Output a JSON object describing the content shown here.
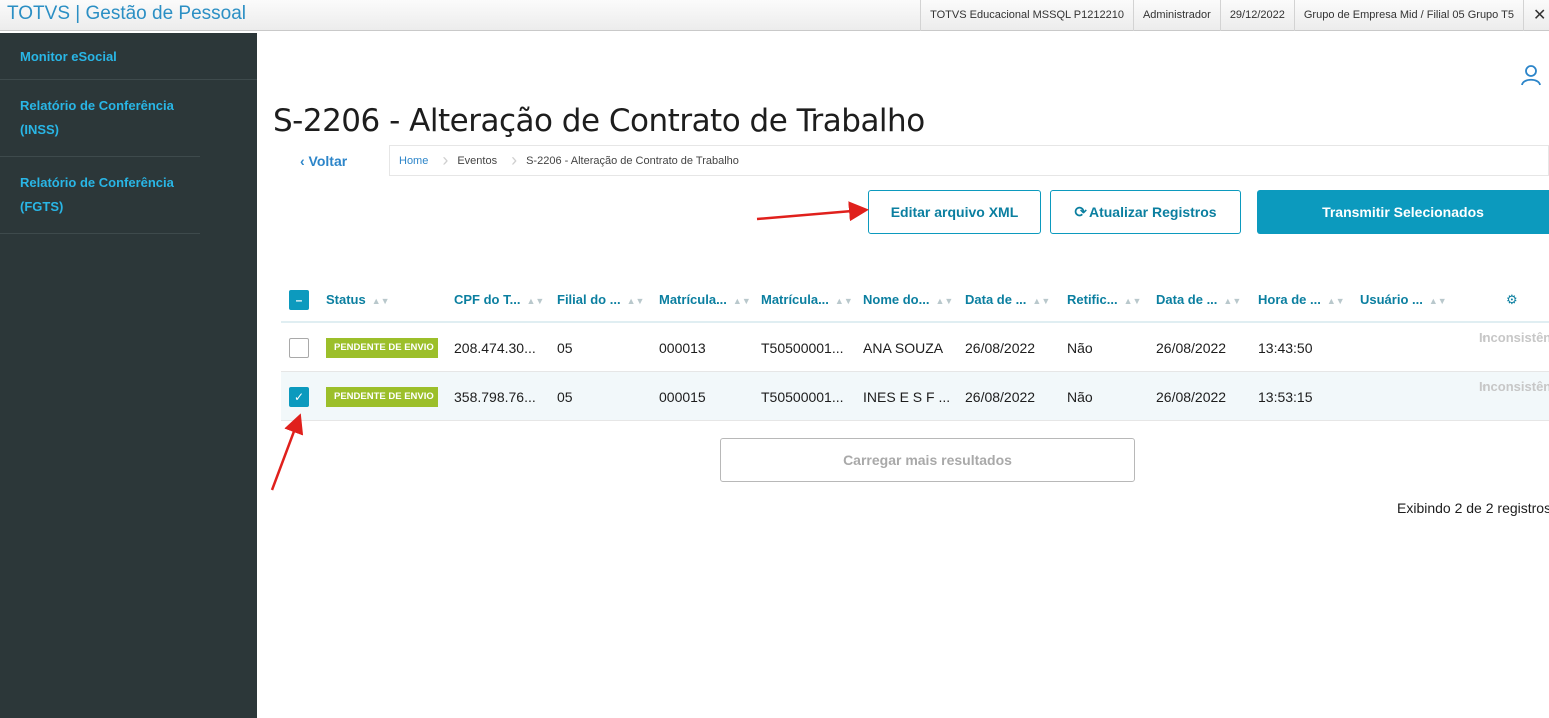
{
  "app": {
    "title": "TOTVS | Gestão de Pessoal"
  },
  "system": {
    "database": "TOTVS Educacional MSSQL P1212210",
    "user": "Administrador",
    "date": "29/12/2022",
    "company": "Grupo de Empresa Mid / Filial 05 Grupo T5",
    "close": "✕"
  },
  "sidebar": {
    "items": [
      {
        "label": "Monitor eSocial"
      },
      {
        "label": "Relatório de Conferência (INSS)"
      },
      {
        "label": "Relatório de Conferência (FGTS)"
      }
    ]
  },
  "page": {
    "title": "S-2206 - Alteração de Contrato de Trabalho",
    "back": "‹ Voltar",
    "breadcrumb": [
      "Home",
      "Eventos",
      "S-2206 - Alteração de Contrato de Trabalho"
    ]
  },
  "actions": {
    "edit_xml": "Editar arquivo XML",
    "refresh": "Atualizar Registros",
    "transmit": "Transmitir Selecionados"
  },
  "table": {
    "columns": [
      "Status",
      "CPF do T...",
      "Filial do ...",
      "Matrícula...",
      "Matrícula...",
      "Nome do...",
      "Data de ...",
      "Retific...",
      "Data de ...",
      "Hora de ...",
      "Usuário ..."
    ],
    "rows": [
      {
        "selected": false,
        "status": "PENDENTE DE ENVIO",
        "cpf": "208.474.30...",
        "filial": "05",
        "matricula": "000013",
        "matricula2": "T50500001...",
        "nome": "ANA SOUZA",
        "data": "26/08/2022",
        "retificacao": "Não",
        "data2": "26/08/2022",
        "hora": "13:43:50",
        "usuario": "",
        "inconsistencias": "Inconsistências"
      },
      {
        "selected": true,
        "status": "PENDENTE DE ENVIO",
        "cpf": "358.798.76...",
        "filial": "05",
        "matricula": "000015",
        "matricula2": "T50500001...",
        "nome": "INES E S F ...",
        "data": "26/08/2022",
        "retificacao": "Não",
        "data2": "26/08/2022",
        "hora": "13:53:15",
        "usuario": "",
        "inconsistencias": "Inconsistências"
      }
    ]
  },
  "load_more": "Carregar mais resultados",
  "count_text": "Exibindo 2 de 2 registros",
  "colors": {
    "accent": "#0c9abe",
    "sidebar": "#2c3739",
    "badge": "#9cbf2a",
    "annotation": "#e0201c"
  }
}
